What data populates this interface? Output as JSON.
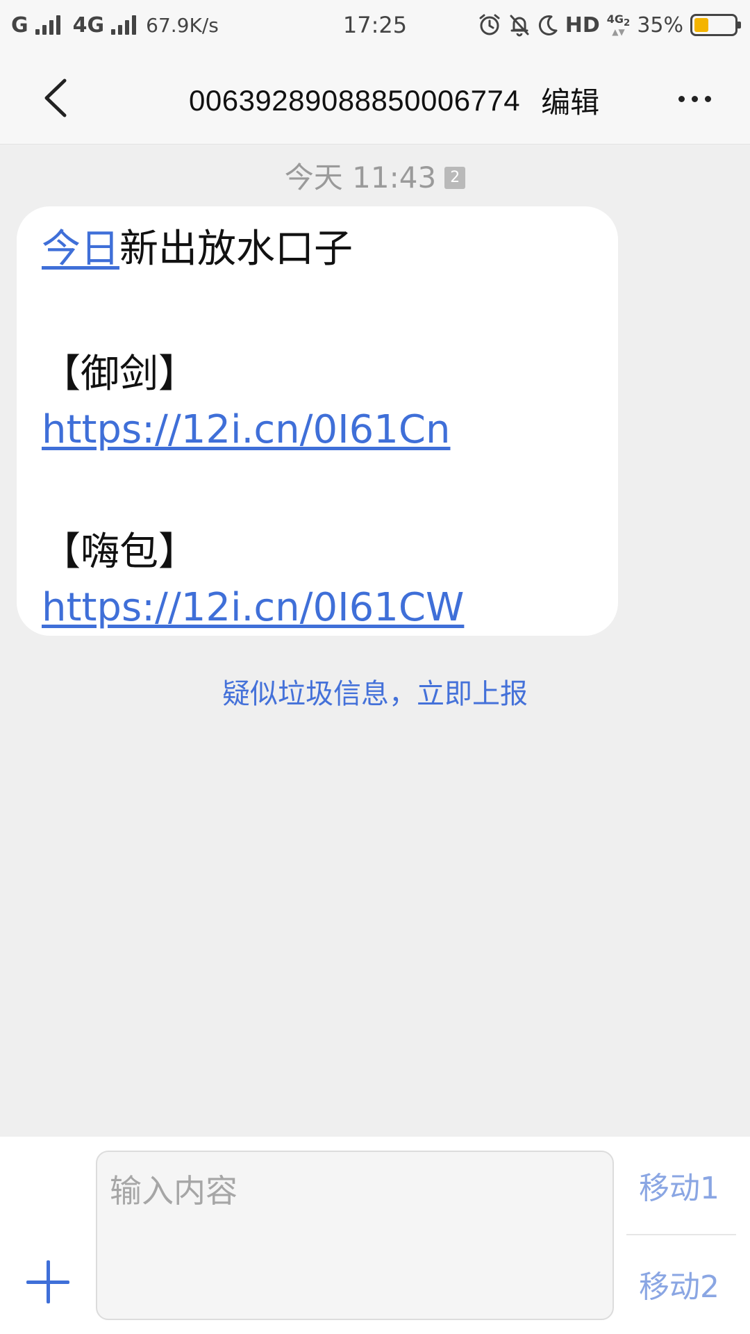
{
  "status_bar": {
    "carrier1": "G",
    "carrier2": "4G",
    "net_speed": "67.9K/s",
    "time": "17:25",
    "hd": "HD",
    "network_badge": "4G",
    "network_badge_sim": "2",
    "battery_percent": "35%",
    "battery_level": 0.35,
    "battery_color": "#f4b400"
  },
  "header": {
    "contact_number": "00639289088850006774",
    "edit_label": "编辑"
  },
  "conversation": {
    "timestamp": "今天 11:43",
    "sim_badge": "2",
    "message": {
      "link_today": "今日",
      "line1_rest": "新出放水口子",
      "label1": "【御剑】",
      "url1": "https://12i.cn/0I61Cn",
      "label2": "【嗨包】",
      "url2": "https://12i.cn/0I61CW"
    },
    "spam_report": "疑似垃圾信息，立即上报"
  },
  "composer": {
    "placeholder": "输入内容",
    "send1_label": "移动1",
    "send2_label": "移动2"
  },
  "colors": {
    "accent": "#3f6fd8",
    "background": "#efefef",
    "bubble": "#ffffff"
  }
}
